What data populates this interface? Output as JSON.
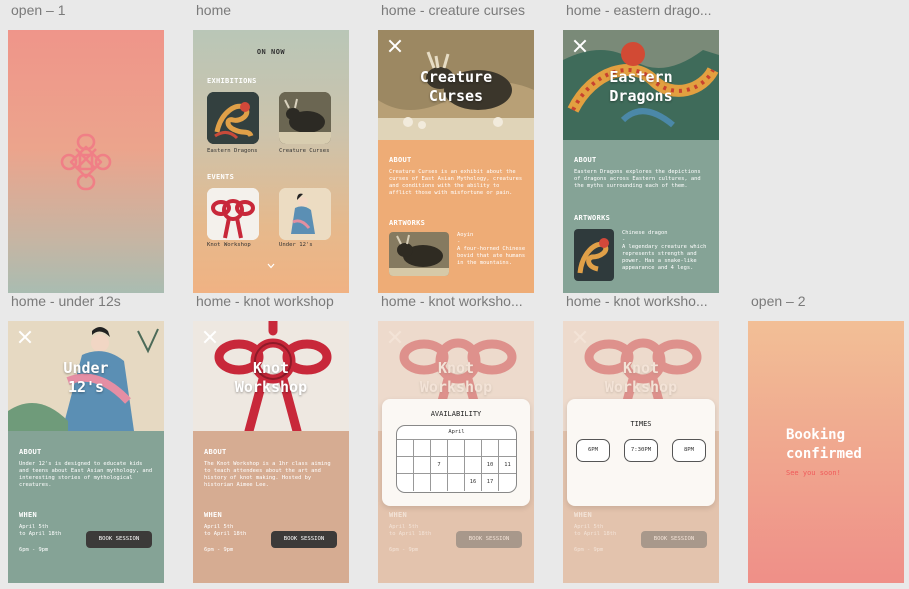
{
  "boards": {
    "open1": "open – 1",
    "home": "home",
    "creature": "home - creature curses",
    "eastern": "home - eastern drago...",
    "under12": "home - under 12s",
    "knot": "home - knot workshop",
    "knot2": "home - knot worksho...",
    "knot3": "home - knot worksho...",
    "open2": "open – 2"
  },
  "home": {
    "title": "ON NOW",
    "exhibitions_heading": "EXHIBITIONS",
    "events_heading": "EVENTS",
    "items": [
      {
        "label": "Eastern Dragons"
      },
      {
        "label": "Creature Curses"
      },
      {
        "label": "Knot Workshop"
      },
      {
        "label": "Under 12's"
      }
    ],
    "scroll_icon": "chevron-down-icon"
  },
  "creature": {
    "title_line1": "Creature",
    "title_line2": "Curses",
    "about_heading": "ABOUT",
    "about_text": "Creature Curses is an exhibit about the curses of East Asian Mythology, creatures and conditions with the ability to afflict those with misfortune or pain.",
    "artworks_heading": "ARTWORKS",
    "art_name": "Aoyin",
    "art_dash": "-",
    "art_desc": "A four-horned Chinese bovid that ate humans in the mountains."
  },
  "eastern": {
    "title_line1": "Eastern",
    "title_line2": "Dragons",
    "about_heading": "ABOUT",
    "about_text": "Eastern Dragons explores the depictions of dragons across Eastern cultures, and the myths surrounding each of them.",
    "artworks_heading": "ARTWORKS",
    "art_name": "Chinese dragon",
    "art_dash": "-",
    "art_desc": "A legendary creature which represents strength and power. Has a snake-like appearance and 4 legs."
  },
  "under12": {
    "title_line1": "Under",
    "title_line2": "12's",
    "about_heading": "ABOUT",
    "about_text": "Under 12's is designed to educate kids and teens about East Asian mythology, and interesting stories of mythological creatures.",
    "when_heading": "WHEN",
    "dates_line1": "April 5th",
    "dates_line2": "to April 18th",
    "time": "6pm - 9pm",
    "button": "BOOK SESSION"
  },
  "knot": {
    "title_line1": "Knot",
    "title_line2": "Workshop",
    "about_heading": "ABOUT",
    "about_text": "The Knot Workshop is a 1hr class aiming to teach attendees about the art and history of knot making. Hosted by historian Aimee Lee.",
    "when_heading": "WHEN",
    "dates_line1": "April 5th",
    "dates_line2": "to April 18th",
    "time": "6pm - 9pm",
    "button": "BOOK SESSION"
  },
  "availability": {
    "heading": "AVAILABILITY",
    "month": "April",
    "days": [
      "7",
      "10",
      "11",
      "16",
      "17"
    ]
  },
  "times": {
    "heading": "TIMES",
    "options": [
      "6PM",
      "7:30PM",
      "8PM"
    ]
  },
  "confirm": {
    "line1": "Booking",
    "line2": "confirmed",
    "sub": "See you soon!"
  },
  "colors": {
    "peach": "#f1b186",
    "sage": "#85a396",
    "salmon": "#ef8d86",
    "dark_button": "#3c3a39",
    "knot_red": "#c8283a"
  }
}
